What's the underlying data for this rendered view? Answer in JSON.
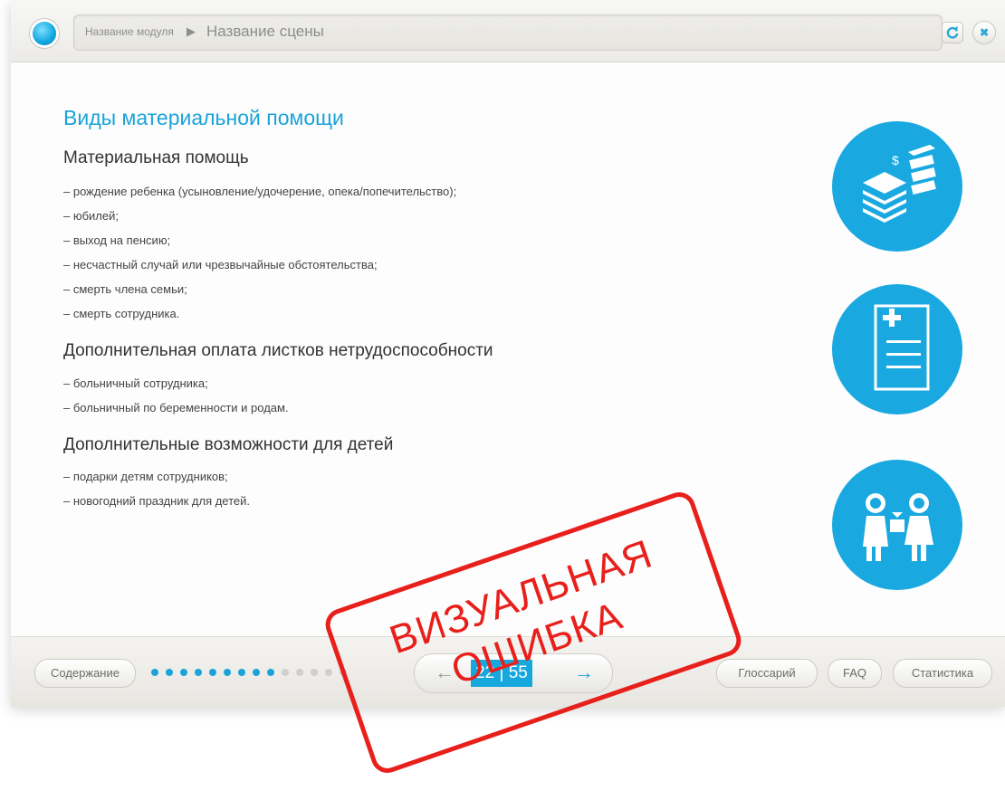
{
  "topbar": {
    "module_name": "Название модуля",
    "separator": "▶",
    "scene_name": "Название сцены",
    "refresh_icon": "refresh-icon",
    "close_icon": "close-icon"
  },
  "content": {
    "title": "Виды материальной помощи",
    "sections": [
      {
        "heading": "Материальная помощь",
        "items": [
          "– рождение ребенка (усыновление/удочерение, опека/попечительство);",
          "– юбилей;",
          "– выход на пенсию;",
          "– несчастный случай или чрезвычайные обстоятельства;",
          "– смерть члена семьи;",
          "– смерть сотрудника."
        ]
      },
      {
        "heading": "Дополнительная оплата листков нетрудоспособности",
        "items": [
          "– больничный сотрудника;",
          "– больничный по беременности и родам."
        ]
      },
      {
        "heading": "Дополнительные возможности для детей",
        "items": [
          "– подарки детям сотрудников;",
          "– новогодний праздник для детей."
        ]
      }
    ],
    "icons": [
      "money-stacks-icon",
      "medical-document-icon",
      "children-gift-icon"
    ]
  },
  "bottombar": {
    "contents_label": "Содержание",
    "glossary_label": "Глоссарий",
    "faq_label": "FAQ",
    "stats_label": "Статистика",
    "counter": "22 | 55",
    "progress": {
      "current": 22,
      "total": 55
    },
    "dots": {
      "filled": 9,
      "empty": 5
    }
  },
  "stamp": {
    "line1": "ВИЗУАЛЬНАЯ",
    "line2": "ОШИБКА"
  },
  "colors": {
    "accent": "#19a9e0",
    "stamp": "#e8201c",
    "dot_filled": "#1aa3d8",
    "dot_empty": "#cfcfcf"
  }
}
